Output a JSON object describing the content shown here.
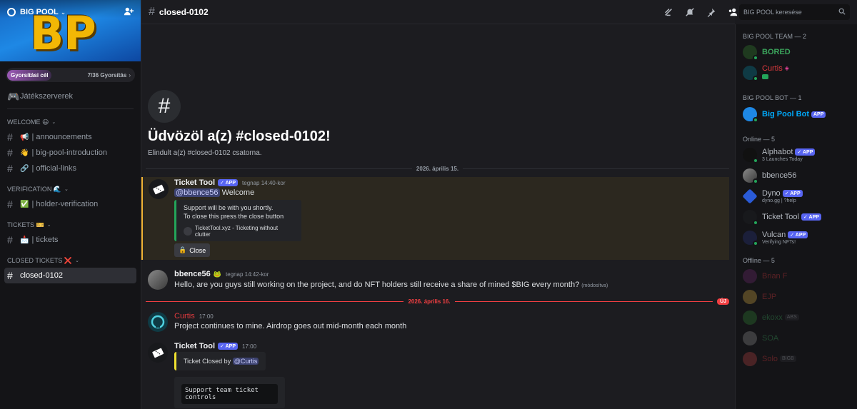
{
  "server": {
    "name": "BIG POOL",
    "banner_letters": "BP",
    "boost_label": "Gyorsítási cél",
    "boost_count": "7/36 Gyorsítás"
  },
  "sidebar": {
    "games_label": "Játékszerverek",
    "categories": [
      {
        "name": "WELCOME 😃",
        "channels": [
          {
            "emoji": "📢",
            "label": "| announcements"
          },
          {
            "emoji": "👋",
            "label": "| big-pool-introduction"
          },
          {
            "emoji": "🔗",
            "label": "| official-links"
          }
        ]
      },
      {
        "name": "VERIFICATION 🌊",
        "channels": [
          {
            "emoji": "✅",
            "label": "| holder-verification"
          }
        ]
      },
      {
        "name": "TICKETS 🎫",
        "channels": [
          {
            "emoji": "📩",
            "label": "| tickets"
          }
        ]
      },
      {
        "name": "CLOSED TICKETS ❌",
        "channels": [
          {
            "emoji": "",
            "label": "closed-0102"
          }
        ]
      }
    ]
  },
  "header": {
    "channel": "closed-0102",
    "search_placeholder": "BIG POOL keresése"
  },
  "welcome": {
    "title": "Üdvözöl a(z) #closed-0102!",
    "subtitle": "Elindult a(z) #closed-0102 csatorna."
  },
  "dates": {
    "first": "2026. április 15.",
    "second": "2026. április 16.",
    "new_badge": "ÚJ"
  },
  "messages": {
    "m1": {
      "author": "Ticket Tool",
      "badge": "APP",
      "time": "tegnap 14:40-kor",
      "mention": "@bbence56",
      "text": "Welcome",
      "embed_line1": "Support will be with you shortly.",
      "embed_line2": "To close this press the close button",
      "embed_footer": "TicketTool.xyz - Ticketing without clutter",
      "button": "Close"
    },
    "m2": {
      "author": "bbence56",
      "time": "tegnap 14:42-kor",
      "text": "Hello, are you guys still working on the project, and do NFT holders still receive a share of mined $BIG every month?",
      "edited": "(módosítva)"
    },
    "m3": {
      "author": "Curtis",
      "time": "17:00",
      "text": "Project continues to mine. Airdrop goes out mid-month each month"
    },
    "m4": {
      "author": "Ticket Tool",
      "badge": "APP",
      "time": "17:00",
      "embed_text": "Ticket Closed by",
      "embed_mention": "@Curtis",
      "code_text": "Support team ticket controls"
    }
  },
  "members": {
    "team_header": "BIG POOL TEAM — 2",
    "team": [
      {
        "name": "BORED"
      },
      {
        "name": "Curtis"
      }
    ],
    "bot_header": "BIG POOL BOT — 1",
    "bot": {
      "name": "Big Pool Bot",
      "badge": "APP"
    },
    "online_header": "Online — 5",
    "online": [
      {
        "name": "Alphabot",
        "badge": "APP",
        "sub": "3 Launches Today"
      },
      {
        "name": "bbence56",
        "badge": "",
        "sub": ""
      },
      {
        "name": "Dyno",
        "badge": "APP",
        "sub": "dyno.gg | ?help"
      },
      {
        "name": "Ticket Tool",
        "badge": "APP",
        "sub": ""
      },
      {
        "name": "Vulcan",
        "badge": "APP",
        "sub": "Verifying NFTs!"
      }
    ],
    "offline_header": "Offline — 5",
    "offline": [
      {
        "name": "Brian F",
        "tag": ""
      },
      {
        "name": "EJP",
        "tag": ""
      },
      {
        "name": "ekoxx",
        "tag": "ABS"
      },
      {
        "name": "SOA",
        "tag": ""
      },
      {
        "name": "Solo",
        "tag": "BIGB"
      }
    ]
  },
  "colors": {
    "accent": "#5865f2",
    "online": "#23a55a",
    "new_line": "#f23f42",
    "bored": "#3ba55c",
    "curtis": "#e03a3e",
    "bot": "#00aafc"
  }
}
